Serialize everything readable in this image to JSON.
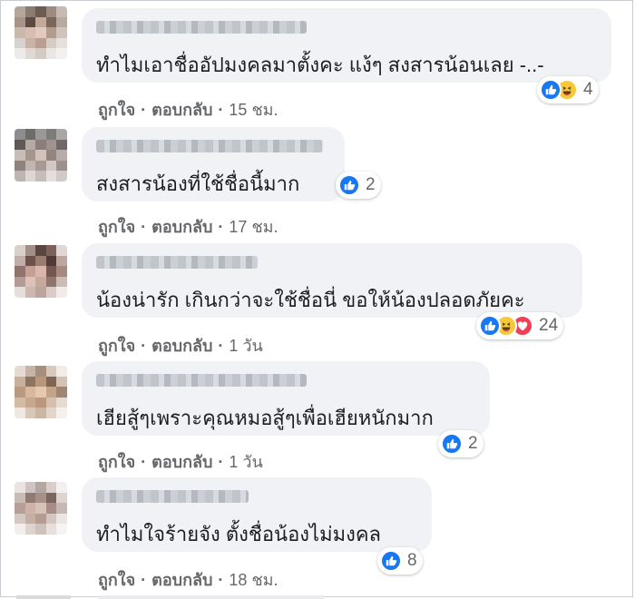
{
  "comments": [
    {
      "text": "ทำไมเอาชื่ออัปมงคลมาตั้งคะ แง้ๆ สงสารน้อนเลย -..-",
      "reaction_count": "4",
      "reaction_icons": [
        "like-icon",
        "haha-icon"
      ],
      "like_label": "ถูกใจ",
      "reply_label": "ตอบกลับ",
      "time": "15 ชม."
    },
    {
      "text": "สงสารน้องที่ใช้ชื่อนี้มาก",
      "reaction_count": "2",
      "reaction_icons": [
        "like-icon"
      ],
      "like_label": "ถูกใจ",
      "reply_label": "ตอบกลับ",
      "time": "17 ชม."
    },
    {
      "text": "น้องน่ารัก เกินกว่าจะใช้ชื่อนี่ ขอให้น้องปลอดภัยคะ",
      "reaction_count": "24",
      "reaction_icons": [
        "like-icon",
        "haha-icon",
        "love-icon"
      ],
      "like_label": "ถูกใจ",
      "reply_label": "ตอบกลับ",
      "time": "1 วัน"
    },
    {
      "text": "เฮียสู้ๆเพราะคุณหมอสู้ๆเพื่อเฮียหนักมาก",
      "reaction_count": "2",
      "reaction_icons": [
        "like-icon"
      ],
      "like_label": "ถูกใจ",
      "reply_label": "ตอบกลับ",
      "time": "1 วัน"
    },
    {
      "text": "ทำไมใจร้ายจัง ตั้งชื่อน้องไม่มงคล",
      "reaction_count": "8",
      "reaction_icons": [
        "like-icon"
      ],
      "like_label": "ถูกใจ",
      "reply_label": "ตอบกลับ",
      "time": "18 ชม."
    }
  ],
  "colors": {
    "bubble": "#f0f2f5",
    "like": "#1877f2",
    "haha": "#f7c93a",
    "love": "#f33e58",
    "meta_text": "#65676b",
    "body_text": "#1c1e21"
  }
}
